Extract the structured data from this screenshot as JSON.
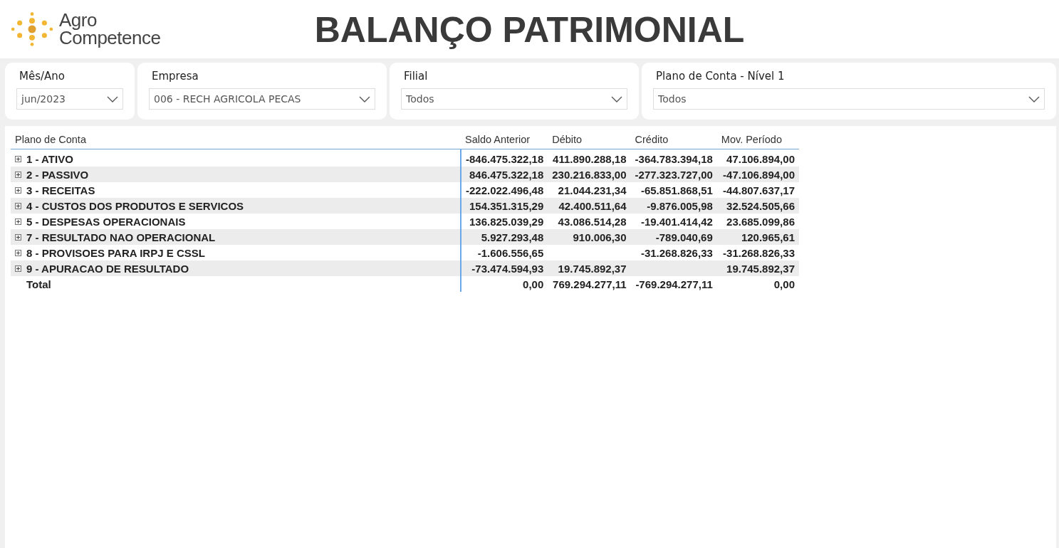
{
  "header": {
    "logo_line_1": "Agro",
    "logo_line_2": "Competence",
    "title": "BALANÇO PATRIMONIAL"
  },
  "filters": [
    {
      "label": "Mês/Ano",
      "value": "jun/2023"
    },
    {
      "label": "Empresa",
      "value": "006 - RECH AGRICOLA PECAS"
    },
    {
      "label": "Filial",
      "value": "Todos"
    },
    {
      "label": "Plano de Conta - Nível 1",
      "value": "Todos"
    }
  ],
  "table": {
    "label_column": "Plano de Conta",
    "value_columns": [
      "Saldo Anterior",
      "Débito",
      "Crédito",
      "Mov. Período"
    ],
    "rows": [
      {
        "kind": "group",
        "expanded": false,
        "label": "1 - ATIVO",
        "cells": [
          "-846.475.322,18",
          "411.890.288,18",
          "-364.783.394,18",
          "47.106.894,00"
        ]
      },
      {
        "kind": "group",
        "expanded": false,
        "label": "2 - PASSIVO",
        "cells": [
          "846.475.322,18",
          "230.216.833,00",
          "-277.323.727,00",
          "-47.106.894,00"
        ]
      },
      {
        "kind": "group",
        "expanded": false,
        "label": "3 - RECEITAS",
        "cells": [
          "-222.022.496,48",
          "21.044.231,34",
          "-65.851.868,51",
          "-44.807.637,17"
        ]
      },
      {
        "kind": "group",
        "expanded": false,
        "label": "4 - CUSTOS DOS PRODUTOS E SERVICOS",
        "cells": [
          "154.351.315,29",
          "42.400.511,64",
          "-9.876.005,98",
          "32.524.505,66"
        ]
      },
      {
        "kind": "group",
        "expanded": false,
        "label": "5 - DESPESAS OPERACIONAIS",
        "cells": [
          "136.825.039,29",
          "43.086.514,28",
          "-19.401.414,42",
          "23.685.099,86"
        ]
      },
      {
        "kind": "group",
        "expanded": false,
        "label": "7 - RESULTADO NAO OPERACIONAL",
        "cells": [
          "5.927.293,48",
          "910.006,30",
          "-789.040,69",
          "120.965,61"
        ]
      },
      {
        "kind": "group",
        "expanded": false,
        "label": "8 - PROVISOES PARA IRPJ E CSSL",
        "cells": [
          "-1.606.556,65",
          null,
          "-31.268.826,33",
          "-31.268.826,33"
        ]
      },
      {
        "kind": "group",
        "expanded": false,
        "label": "9 - APURACAO DE RESULTADO",
        "cells": [
          "-73.474.594,93",
          "19.745.892,37",
          null,
          "19.745.892,37"
        ]
      },
      {
        "kind": "total",
        "label": "Total",
        "cells": [
          "0,00",
          "769.294.277,11",
          "-769.294.277,11",
          "0,00"
        ]
      }
    ]
  }
}
